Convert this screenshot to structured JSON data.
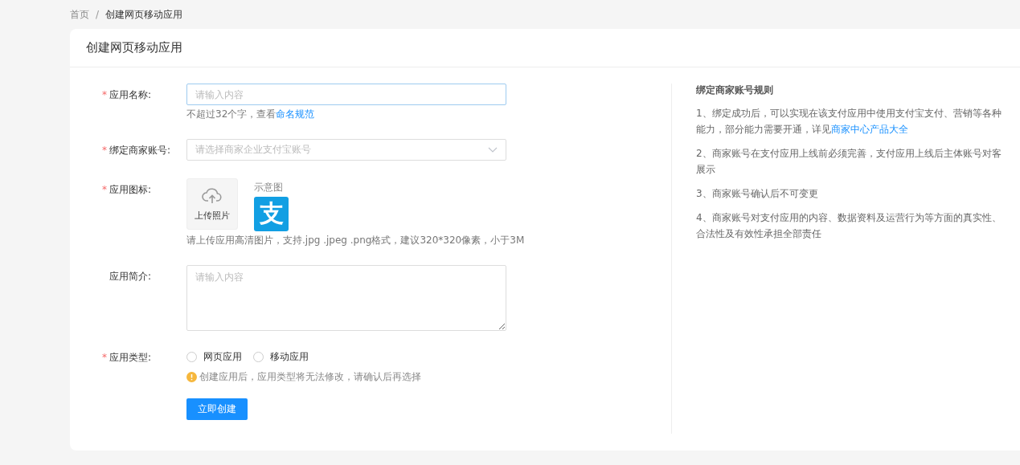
{
  "breadcrumb": {
    "separator": "/",
    "items": [
      {
        "label": "首页",
        "current": false
      },
      {
        "label": "创建网页移动应用",
        "current": true
      }
    ]
  },
  "card": {
    "title": "创建网页移动应用"
  },
  "required_mark": "*",
  "fields": [
    {
      "kind": "input",
      "label": "应用名称:",
      "required": true,
      "placeholder": "请输入内容",
      "hint": {
        "text": "不超过32个字，查看",
        "link": "命名规范"
      }
    },
    {
      "kind": "select",
      "label": "绑定商家账号:",
      "required": true,
      "placeholder": "请选择商家企业支付宝账号"
    },
    {
      "kind": "upload",
      "label": "应用图标:",
      "required": true,
      "upload_label": "上传照片",
      "sample_label": "示意图",
      "sample_glyph": "支",
      "hint": "请上传应用高清图片，支持.jpg .jpeg .png格式，建议320*320像素，小于3M"
    },
    {
      "kind": "textarea",
      "label": "应用简介:",
      "required": false,
      "placeholder": "请输入内容"
    },
    {
      "kind": "radio",
      "label": "应用类型:",
      "required": true,
      "options": [
        {
          "label": "网页应用",
          "selected": false
        },
        {
          "label": "移动应用",
          "selected": false
        }
      ],
      "warning": "创建应用后，应用类型将无法修改，请确认后再选择"
    }
  ],
  "submit": "立即创建",
  "rules": {
    "title": "绑定商家账号规则",
    "items": [
      {
        "text": "1、绑定成功后，可以实现在该支付应用中使用支付宝支付、营销等各种能力，部分能力需要开通，详见",
        "link": "商家中心产品大全"
      },
      {
        "text": "2、商家账号在支付应用上线前必须完善，支付应用上线后主体账号对客展示"
      },
      {
        "text": "3、商家账号确认后不可变更"
      },
      {
        "text": "4、商家账号对支付应用的内容、数据资料及运营行为等方面的真实性、合法性及有效性承担全部责任"
      }
    ]
  }
}
